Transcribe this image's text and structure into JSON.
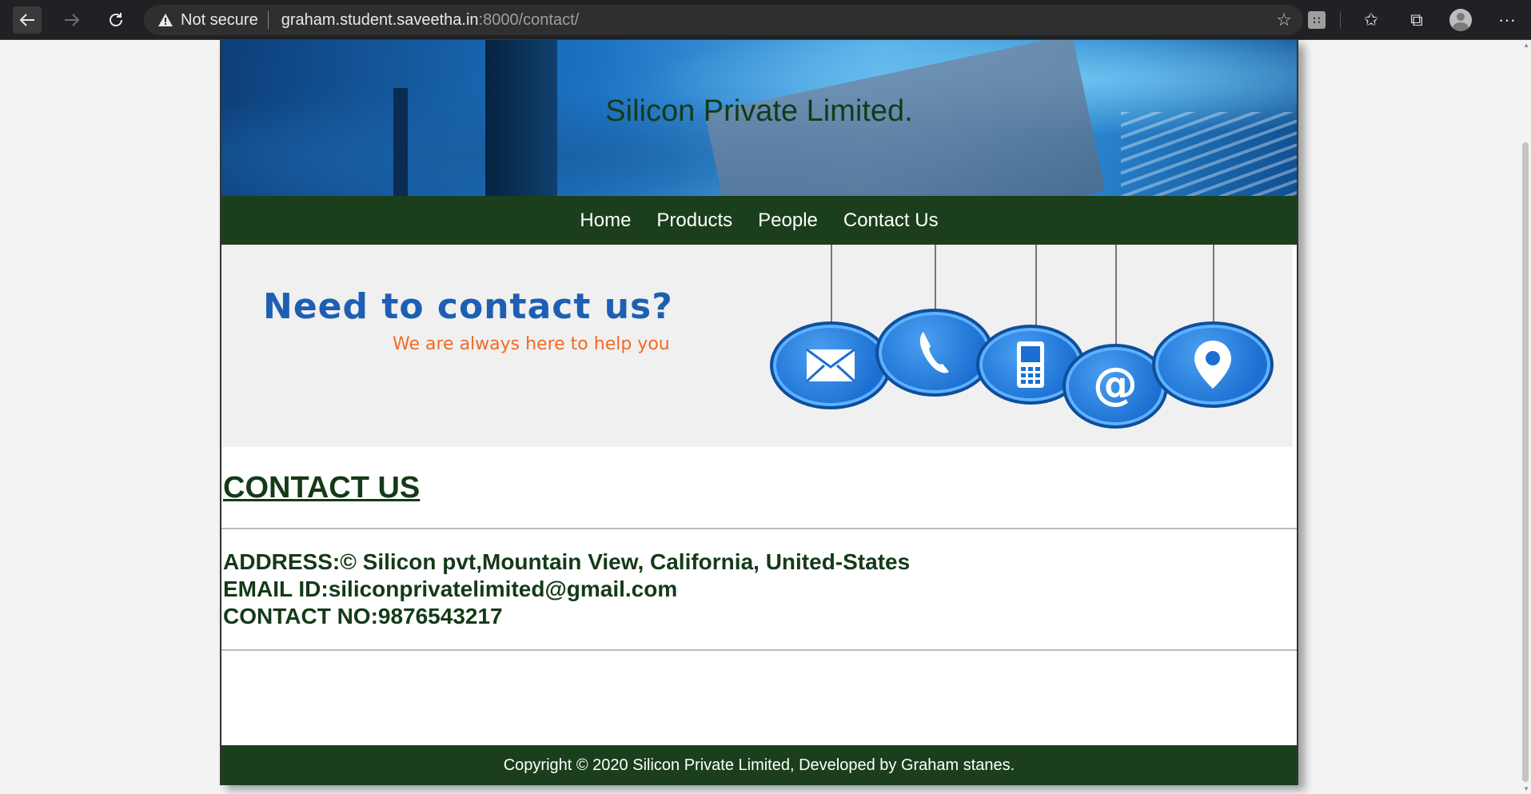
{
  "browser": {
    "security_label": "Not secure",
    "url_host": "graham.student.saveetha.in",
    "url_path": ":8000/contact/"
  },
  "site": {
    "title": "Silicon Private Limited.",
    "nav": [
      "Home",
      "Products",
      "People",
      "Contact Us"
    ],
    "banner": {
      "heading": "Need to contact us?",
      "subheading": "We are always here to help you",
      "icons": [
        "envelope-icon",
        "phone-icon",
        "mobile-icon",
        "at-icon",
        "location-icon"
      ]
    },
    "contact_title": "CONTACT US",
    "address": "ADDRESS:© Silicon pvt,Mountain View, California, United-States",
    "email": "EMAIL ID:siliconprivatelimited@gmail.com",
    "phone": "CONTACT NO:9876543217",
    "footer": "Copyright © 2020 Silicon Private Limited, Developed by Graham stanes."
  },
  "colors": {
    "dark_green": "#1b3f1d",
    "text_green": "#143a18",
    "banner_blue": "#1d5fb3",
    "banner_orange": "#f26a23"
  }
}
